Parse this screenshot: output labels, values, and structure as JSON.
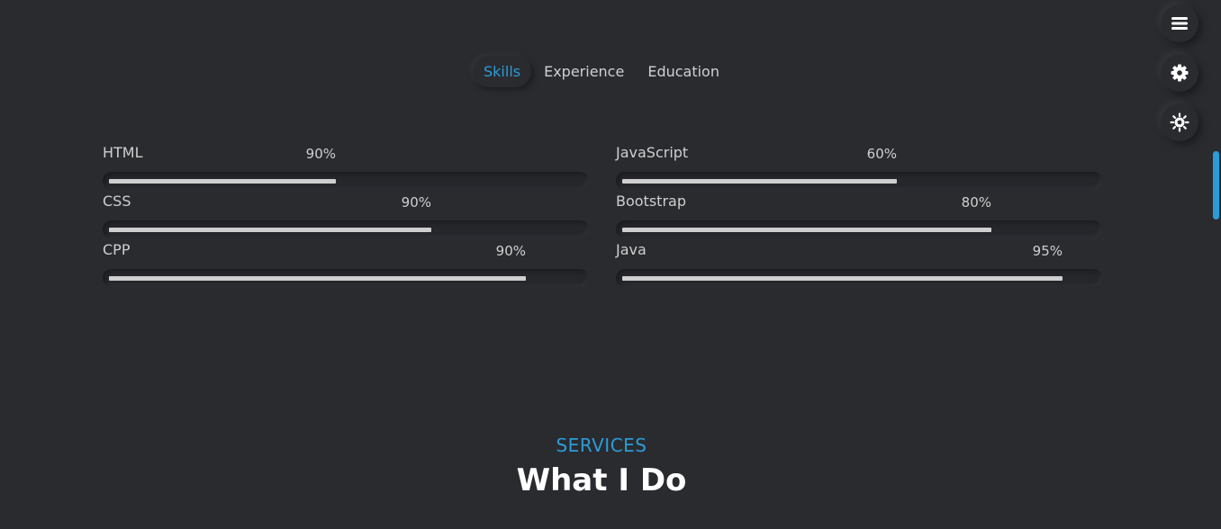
{
  "tabs": [
    {
      "label": "Skills",
      "active": true
    },
    {
      "label": "Experience",
      "active": false
    },
    {
      "label": "Education",
      "active": false
    }
  ],
  "skills": [
    {
      "name": "HTML",
      "percent_label": "90%",
      "fill_fraction": 0.48
    },
    {
      "name": "JavaScript",
      "percent_label": "60%",
      "fill_fraction": 0.58
    },
    {
      "name": "CSS",
      "percent_label": "90%",
      "fill_fraction": 0.68
    },
    {
      "name": "Bootstrap",
      "percent_label": "80%",
      "fill_fraction": 0.78
    },
    {
      "name": "CPP",
      "percent_label": "90%",
      "fill_fraction": 0.88
    },
    {
      "name": "Java",
      "percent_label": "95%",
      "fill_fraction": 0.93
    }
  ],
  "floating_buttons": [
    {
      "icon": "menu-icon"
    },
    {
      "icon": "gear-icon"
    },
    {
      "icon": "sun-icon"
    }
  ],
  "services": {
    "label": "SERVICES",
    "title": "What I Do"
  },
  "colors": {
    "background": "#2a2b2f",
    "accent": "#2b9cd8",
    "text": "#d6d6d6",
    "bar_fill": "#cfcfcf"
  }
}
